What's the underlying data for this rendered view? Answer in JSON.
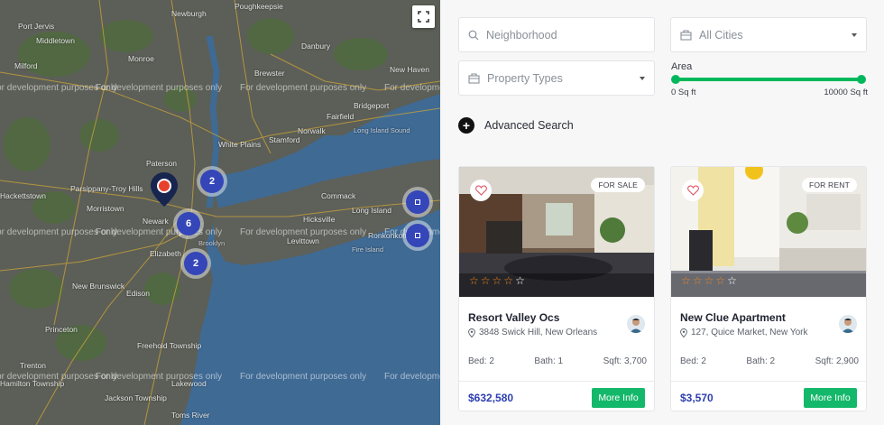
{
  "map": {
    "watermark": "For development purposes only",
    "cities": [
      "Port Jervis",
      "Middletown",
      "Monroe",
      "Milford",
      "Newburgh",
      "Poughkeepsie",
      "Danbury",
      "New Haven",
      "Bridgeport",
      "Fairfield",
      "Norwalk",
      "Stamford",
      "Brewster",
      "White Plains",
      "Paterson",
      "Newark",
      "Parsippany-Troy Hills",
      "Hackettstown",
      "Morristown",
      "Brooklyn",
      "Elizabeth",
      "Edison",
      "New Brunswick",
      "Hicksville",
      "Levittown",
      "Long Island",
      "Commack",
      "Ronkonkoma",
      "Fire Island",
      "Trenton",
      "Freehold Township",
      "Toms River",
      "Jackson Township",
      "Hamilton Township",
      "Princeton",
      "Lakewood",
      "Long Island Sound"
    ],
    "clusters": [
      {
        "label": "2"
      },
      {
        "label": "6"
      },
      {
        "label": "2"
      },
      {
        "label": ""
      },
      {
        "label": ""
      }
    ],
    "fullscreen_icon": "fullscreen-icon",
    "marker_color": "#e8412b"
  },
  "search": {
    "neighborhood_placeholder": "Neighborhood",
    "cities_value": "All Cities",
    "property_types_value": "Property Types",
    "area_label": "Area",
    "area_min": "0 Sq ft",
    "area_max": "10000 Sq ft",
    "advanced_label": "Advanced Search",
    "slider_color": "#00b85c"
  },
  "listings": [
    {
      "status": "FOR SALE",
      "rating": 4,
      "title": "Resort Valley Ocs",
      "address": "3848 Swick Hill, New Orleans",
      "bed": "Bed: 2",
      "bath": "Bath: 1",
      "sqft": "Sqft: 3,700",
      "price": "$632,580",
      "button": "More Info"
    },
    {
      "status": "FOR RENT",
      "rating": 4,
      "title": "New Clue Apartment",
      "address": "127, Quice Market, New York",
      "bed": "Bed: 2",
      "bath": "Bath: 2",
      "sqft": "Sqft: 2,900",
      "price": "$3,570",
      "button": "More Info"
    }
  ],
  "colors": {
    "price": "#2c3eb0",
    "button": "#14b86a",
    "star": "#f5881f",
    "cluster": "#3446b8"
  }
}
